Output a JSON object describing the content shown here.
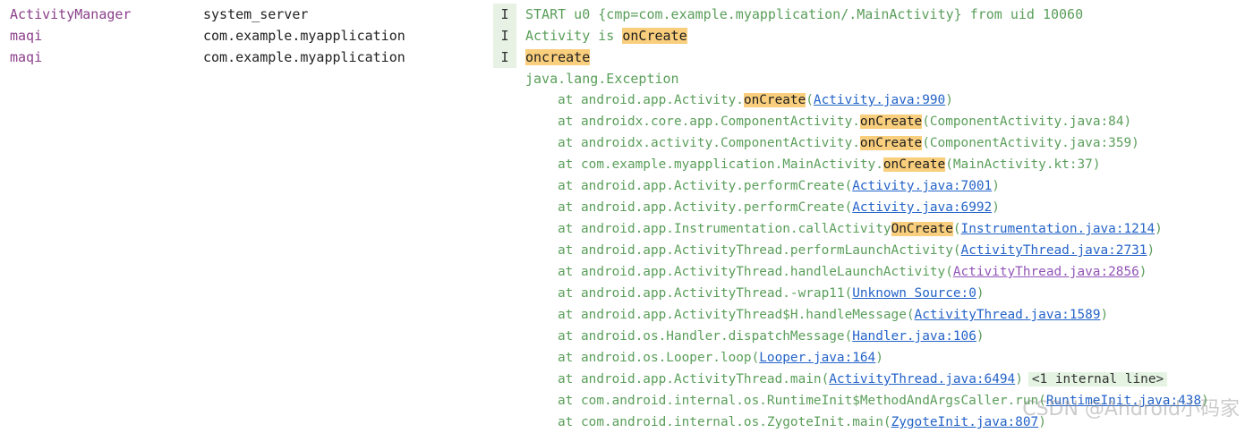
{
  "colors": {
    "tag": "#8a3f8a",
    "message_info": "#5a9e5a",
    "highlight": "#f9ce7c",
    "link": "#2463c8",
    "link_visited": "#9255b8",
    "level_bg": "#e7f2e4"
  },
  "rows": [
    {
      "tag": "ActivityManager",
      "pkg": "system_server",
      "level": "I",
      "parts": [
        {
          "t": "START u0 {cmp=com.example.myapplication/.MainActivity} from uid 10060",
          "k": "text"
        }
      ]
    },
    {
      "tag": "maqi",
      "pkg": "com.example.myapplication",
      "level": "I",
      "parts": [
        {
          "t": "Activity is ",
          "k": "text"
        },
        {
          "t": "onCreate",
          "k": "hl"
        }
      ]
    },
    {
      "tag": "maqi",
      "pkg": "com.example.myapplication",
      "level": "I",
      "parts": [
        {
          "t": "oncreate",
          "k": "hl"
        }
      ]
    },
    {
      "indent": false,
      "parts": [
        {
          "t": "java.lang.Exception",
          "k": "text"
        }
      ]
    },
    {
      "indent": true,
      "parts": [
        {
          "t": "at android.app.Activity.",
          "k": "text"
        },
        {
          "t": "onCreate",
          "k": "hl"
        },
        {
          "t": "(",
          "k": "text"
        },
        {
          "t": "Activity.java:990",
          "k": "link"
        },
        {
          "t": ")",
          "k": "text"
        }
      ]
    },
    {
      "indent": true,
      "parts": [
        {
          "t": "at androidx.core.app.ComponentActivity.",
          "k": "text"
        },
        {
          "t": "onCreate",
          "k": "hl"
        },
        {
          "t": "(ComponentActivity.java:84)",
          "k": "text"
        }
      ]
    },
    {
      "indent": true,
      "parts": [
        {
          "t": "at androidx.activity.ComponentActivity.",
          "k": "text"
        },
        {
          "t": "onCreate",
          "k": "hl"
        },
        {
          "t": "(ComponentActivity.java:359)",
          "k": "text"
        }
      ]
    },
    {
      "indent": true,
      "parts": [
        {
          "t": "at com.example.myapplication.MainActivity.",
          "k": "text"
        },
        {
          "t": "onCreate",
          "k": "hl"
        },
        {
          "t": "(MainActivity.kt:37)",
          "k": "text"
        }
      ]
    },
    {
      "indent": true,
      "parts": [
        {
          "t": "at android.app.Activity.performCreate(",
          "k": "text"
        },
        {
          "t": "Activity.java:7001",
          "k": "link"
        },
        {
          "t": ")",
          "k": "text"
        }
      ]
    },
    {
      "indent": true,
      "parts": [
        {
          "t": "at android.app.Activity.performCreate(",
          "k": "text"
        },
        {
          "t": "Activity.java:6992",
          "k": "link"
        },
        {
          "t": ")",
          "k": "text"
        }
      ]
    },
    {
      "indent": true,
      "parts": [
        {
          "t": "at android.app.Instrumentation.callActivity",
          "k": "text"
        },
        {
          "t": "OnCreate",
          "k": "hl"
        },
        {
          "t": "(",
          "k": "text"
        },
        {
          "t": "Instrumentation.java:1214",
          "k": "link"
        },
        {
          "t": ")",
          "k": "text"
        }
      ]
    },
    {
      "indent": true,
      "parts": [
        {
          "t": "at android.app.ActivityThread.performLaunchActivity(",
          "k": "text"
        },
        {
          "t": "ActivityThread.java:2731",
          "k": "link"
        },
        {
          "t": ")",
          "k": "text"
        }
      ]
    },
    {
      "indent": true,
      "parts": [
        {
          "t": "at android.app.ActivityThread.handleLaunchActivity(",
          "k": "text"
        },
        {
          "t": "ActivityThread.java:2856",
          "k": "vlink"
        },
        {
          "t": ")",
          "k": "text"
        }
      ]
    },
    {
      "indent": true,
      "parts": [
        {
          "t": "at android.app.ActivityThread.-wrap11(",
          "k": "text"
        },
        {
          "t": "Unknown Source:0",
          "k": "link"
        },
        {
          "t": ")",
          "k": "text"
        }
      ]
    },
    {
      "indent": true,
      "parts": [
        {
          "t": "at android.app.ActivityThread$H.handleMessage(",
          "k": "text"
        },
        {
          "t": "ActivityThread.java:1589",
          "k": "link"
        },
        {
          "t": ")",
          "k": "text"
        }
      ]
    },
    {
      "indent": true,
      "parts": [
        {
          "t": "at android.os.Handler.dispatchMessage(",
          "k": "text"
        },
        {
          "t": "Handler.java:106",
          "k": "link"
        },
        {
          "t": ")",
          "k": "text"
        }
      ]
    },
    {
      "indent": true,
      "parts": [
        {
          "t": "at android.os.Looper.loop(",
          "k": "text"
        },
        {
          "t": "Looper.java:164",
          "k": "link"
        },
        {
          "t": ")",
          "k": "text"
        }
      ]
    },
    {
      "indent": true,
      "parts": [
        {
          "t": "at android.app.ActivityThread.main(",
          "k": "text"
        },
        {
          "t": "ActivityThread.java:6494",
          "k": "link"
        },
        {
          "t": ")",
          "k": "text"
        },
        {
          "t": "<1 internal line>",
          "k": "badge"
        }
      ]
    },
    {
      "indent": true,
      "parts": [
        {
          "t": "at com.android.internal.os.RuntimeInit$MethodAndArgsCaller.run(",
          "k": "text"
        },
        {
          "t": "RuntimeInit.java:438",
          "k": "link"
        },
        {
          "t": ")",
          "k": "text"
        }
      ]
    },
    {
      "indent": true,
      "parts": [
        {
          "t": "at com.android.internal.os.ZygoteInit.main(",
          "k": "text"
        },
        {
          "t": "ZygoteInit.java:807",
          "k": "link"
        },
        {
          "t": ")",
          "k": "text"
        }
      ]
    }
  ],
  "watermark": "CSDN @Android小码家"
}
